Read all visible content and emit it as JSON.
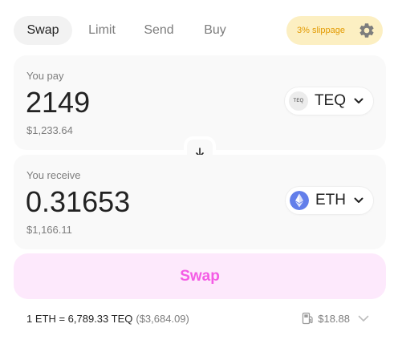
{
  "tabs": [
    {
      "label": "Swap",
      "active": true
    },
    {
      "label": "Limit",
      "active": false
    },
    {
      "label": "Send",
      "active": false
    },
    {
      "label": "Buy",
      "active": false
    }
  ],
  "slippage": {
    "label": "3% slippage",
    "icon": "gear-icon"
  },
  "pay": {
    "label": "You pay",
    "amount": "2149",
    "fiat": "$1,233.64",
    "token": {
      "symbol": "TEQ",
      "icon_text": "TEQ"
    }
  },
  "receive": {
    "label": "You receive",
    "amount": "0.31653",
    "fiat": "$1,166.11",
    "token": {
      "symbol": "ETH",
      "icon": "eth-icon"
    }
  },
  "swap_button": {
    "label": "Swap"
  },
  "rate": {
    "text": "1 ETH = 6,789.33 TEQ",
    "fiat": "($3,684.09)"
  },
  "gas": {
    "value": "$18.88",
    "icon": "gas-pump-icon"
  },
  "colors": {
    "accent": "#f45be5",
    "accent_bg": "#fde9fc",
    "slippage_text": "#e29a00",
    "slippage_bg": "#fcefc2",
    "eth": "#627eea"
  }
}
